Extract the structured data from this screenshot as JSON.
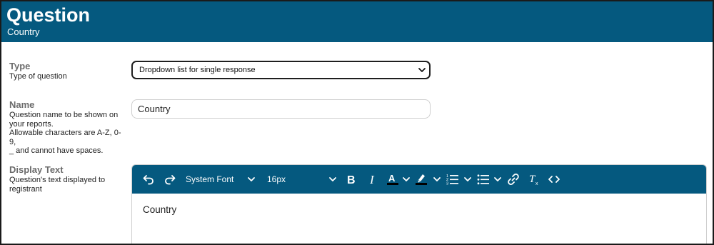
{
  "header": {
    "title": "Question",
    "subtitle": "Country"
  },
  "fields": {
    "type": {
      "label": "Type",
      "description": "Type of question",
      "selected_value": "Dropdown list for single response"
    },
    "name": {
      "label": "Name",
      "description_lines": [
        "Question name to be shown on",
        "your reports.",
        "Allowable characters are A-Z, 0-9,",
        "_ and cannot have spaces."
      ],
      "value": "Country"
    },
    "display_text": {
      "label": "Display Text",
      "description_lines": [
        "Question's text displayed to",
        "registrant"
      ]
    }
  },
  "editor": {
    "toolbar": {
      "font_family": "System Font",
      "font_size": "16px",
      "icons": [
        "undo-icon",
        "redo-icon",
        "bold-icon",
        "italic-icon",
        "text-color-icon",
        "highlight-icon",
        "numbered-list-icon",
        "bullet-list-icon",
        "link-icon",
        "clear-format-icon",
        "source-code-icon"
      ]
    },
    "content": "Country"
  },
  "colors": {
    "primary": "#05597f",
    "text_color_swatch": "#000000",
    "highlight_swatch": "#000000"
  }
}
